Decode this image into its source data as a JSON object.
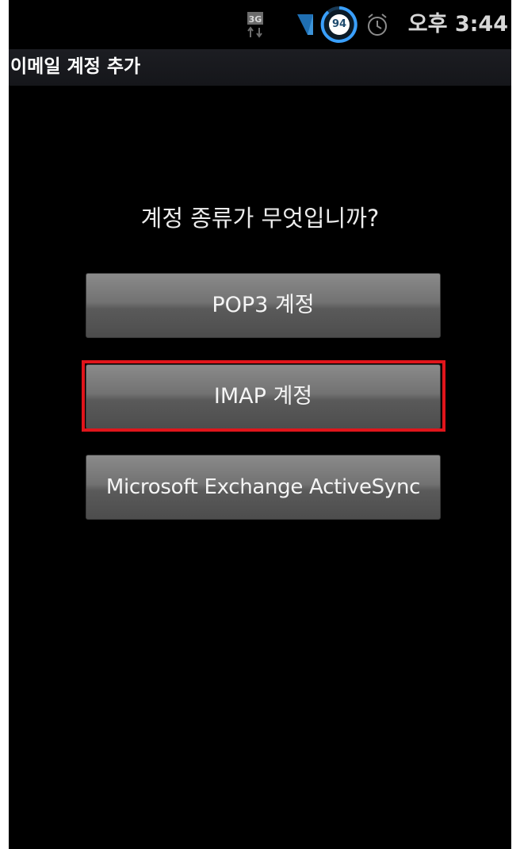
{
  "status_bar": {
    "network_badge": "3G",
    "battery_level": "94",
    "clock": "오후 3:44",
    "icons": [
      "3g-data-icon",
      "signal-icon",
      "battery-icon",
      "alarm-icon"
    ]
  },
  "title_bar": {
    "title": "이메일 계정 추가"
  },
  "main": {
    "question": "계정 종류가 무엇입니까?",
    "options": [
      {
        "label": "POP3 계정"
      },
      {
        "label": "IMAP 계정"
      },
      {
        "label": "Microsoft Exchange ActiveSync"
      }
    ]
  },
  "colors": {
    "background": "#000000",
    "highlight": "#e0151b",
    "battery_ring": "#3aa0ff"
  }
}
